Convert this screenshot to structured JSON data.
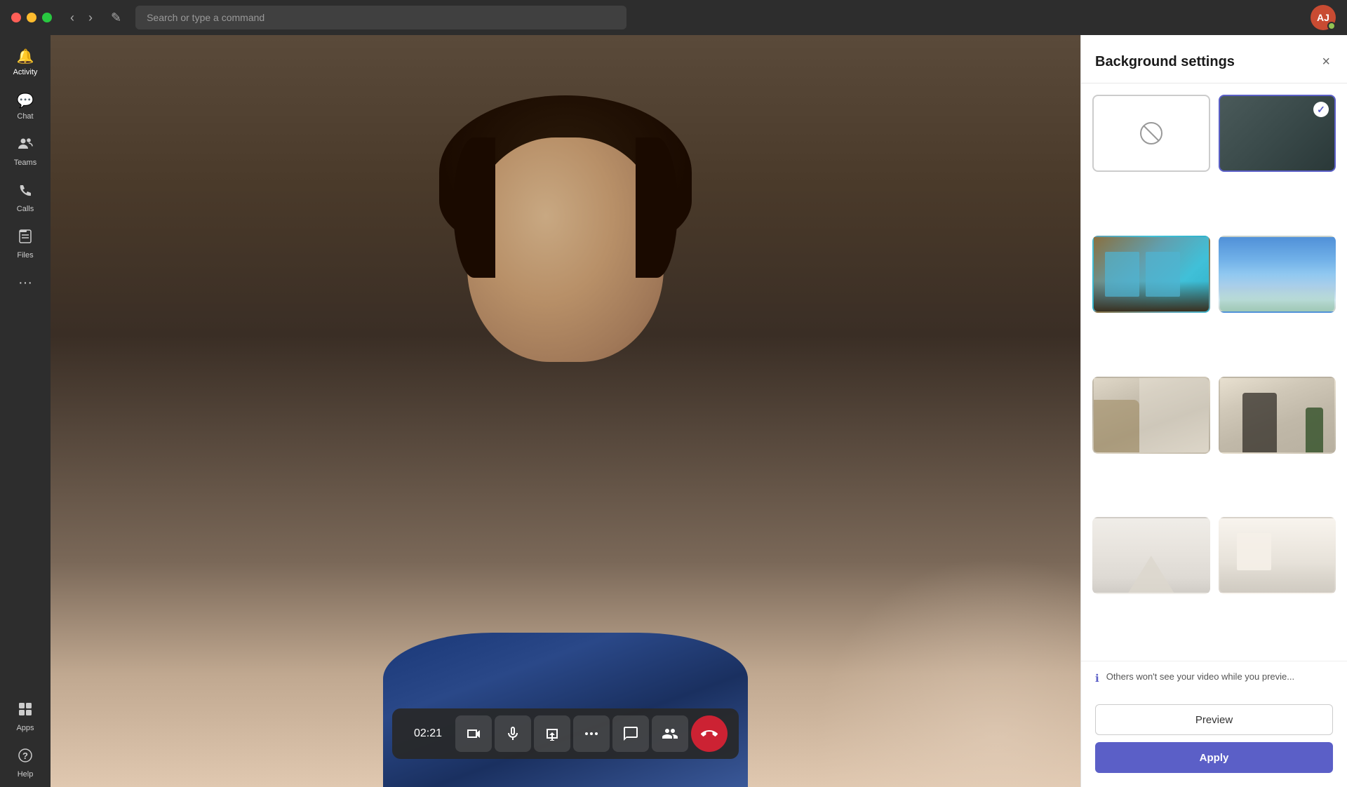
{
  "titlebar": {
    "search_placeholder": "Search or type a command",
    "back_btn": "‹",
    "forward_btn": "›",
    "compose_btn": "✎"
  },
  "sidebar": {
    "items": [
      {
        "id": "activity",
        "label": "Activity",
        "icon": "🔔"
      },
      {
        "id": "chat",
        "label": "Chat",
        "icon": "💬"
      },
      {
        "id": "teams",
        "label": "Teams",
        "icon": "👥"
      },
      {
        "id": "calls",
        "label": "Calls",
        "icon": "📞"
      },
      {
        "id": "files",
        "label": "Files",
        "icon": "📄"
      },
      {
        "id": "more",
        "label": "...",
        "icon": "···"
      },
      {
        "id": "apps",
        "label": "Apps",
        "icon": "⊞"
      },
      {
        "id": "help",
        "label": "Help",
        "icon": "?"
      }
    ]
  },
  "call": {
    "timer": "02:21",
    "controls": [
      {
        "id": "video",
        "icon": "📹",
        "label": "Camera"
      },
      {
        "id": "mic",
        "icon": "🎤",
        "label": "Microphone"
      },
      {
        "id": "share",
        "icon": "⬆",
        "label": "Share screen"
      },
      {
        "id": "more",
        "icon": "···",
        "label": "More"
      },
      {
        "id": "chat",
        "icon": "💬",
        "label": "Chat"
      },
      {
        "id": "people",
        "icon": "👤",
        "label": "People"
      },
      {
        "id": "end",
        "icon": "📵",
        "label": "End call"
      }
    ]
  },
  "bg_panel": {
    "title": "Background settings",
    "close_label": "×",
    "info_text": "Others won't see your video while you previe...",
    "preview_label": "Preview",
    "apply_label": "Apply",
    "options": [
      {
        "id": "none",
        "type": "none",
        "selected": false
      },
      {
        "id": "dark",
        "type": "dark",
        "selected": true
      },
      {
        "id": "interior1",
        "type": "interior1",
        "selected": false
      },
      {
        "id": "office",
        "type": "office",
        "selected": false
      },
      {
        "id": "office2",
        "type": "office2",
        "selected": false
      },
      {
        "id": "office3",
        "type": "office3",
        "selected": false
      },
      {
        "id": "minimal1",
        "type": "minimal1",
        "selected": false
      },
      {
        "id": "minimal2",
        "type": "minimal2",
        "selected": false
      }
    ]
  },
  "avatar": {
    "initials": "AJ"
  }
}
